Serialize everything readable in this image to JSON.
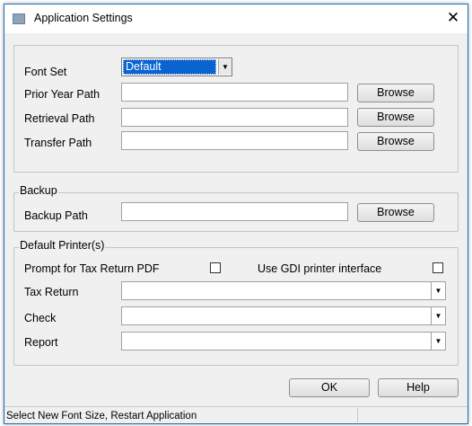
{
  "window": {
    "title": "Application Settings",
    "close_glyph": "✕"
  },
  "settings": {
    "font_set": {
      "label": "Font Set",
      "value": "Default"
    },
    "prior_year": {
      "label": "Prior Year Path",
      "value": "",
      "button": "Browse"
    },
    "retrieval": {
      "label": "Retrieval Path",
      "value": "",
      "button": "Browse"
    },
    "transfer": {
      "label": "Transfer Path",
      "value": "",
      "button": "Browse"
    }
  },
  "backup": {
    "group_label": "Backup",
    "path": {
      "label": "Backup Path",
      "value": "",
      "button": "Browse"
    }
  },
  "printers": {
    "group_label": "Default Printer(s)",
    "prompt_pdf": {
      "label": "Prompt for Tax Return PDF",
      "checked": false
    },
    "use_gdi": {
      "label": "Use GDI printer interface",
      "checked": false
    },
    "tax_return": {
      "label": "Tax Return",
      "value": ""
    },
    "check": {
      "label": "Check",
      "value": ""
    },
    "report": {
      "label": "Report",
      "value": ""
    }
  },
  "buttons": {
    "ok": "OK",
    "help": "Help"
  },
  "status": {
    "text": "Select New Font Size, Restart Application"
  },
  "colors": {
    "selection": "#0a64d0",
    "window_border": "#1f6fb5",
    "dialog_bg": "#f0f0f0"
  }
}
